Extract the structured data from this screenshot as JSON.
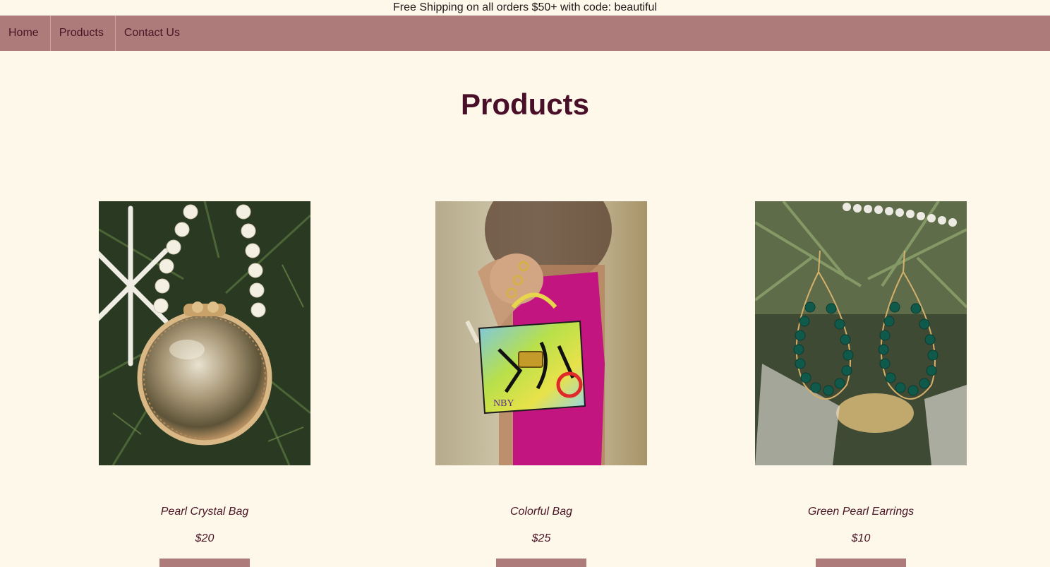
{
  "promo": {
    "text": "Free Shipping on all orders $50+ with code: beautiful"
  },
  "nav": {
    "items": [
      {
        "label": "Home"
      },
      {
        "label": "Products"
      },
      {
        "label": "Contact Us"
      }
    ]
  },
  "page": {
    "title": "Products"
  },
  "products": [
    {
      "name": "Pearl Crystal Bag",
      "price": "$20"
    },
    {
      "name": "Colorful Bag",
      "price": "$25"
    },
    {
      "name": "Green Pearl Earrings",
      "price": "$10"
    }
  ],
  "colors": {
    "background": "#fdf8ea",
    "nav": "#ae7b7b",
    "title": "#4a0f28",
    "text": "#4a1326"
  }
}
